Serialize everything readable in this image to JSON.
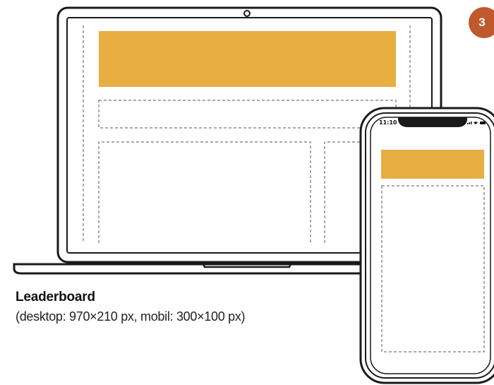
{
  "badge": {
    "number": "3",
    "color": "#C05A2C"
  },
  "caption": {
    "title": "Leaderboard",
    "subtitle": "(desktop: 970×210 px, mobil: 300×100 px)"
  },
  "phone": {
    "status_time": "11:10"
  },
  "colors": {
    "ad_fill": "#E8AE42",
    "outline": "#1a1a1a",
    "dashed": "#555555"
  },
  "icons": [
    "camera-icon",
    "signal-icon",
    "wifi-icon",
    "battery-icon"
  ]
}
